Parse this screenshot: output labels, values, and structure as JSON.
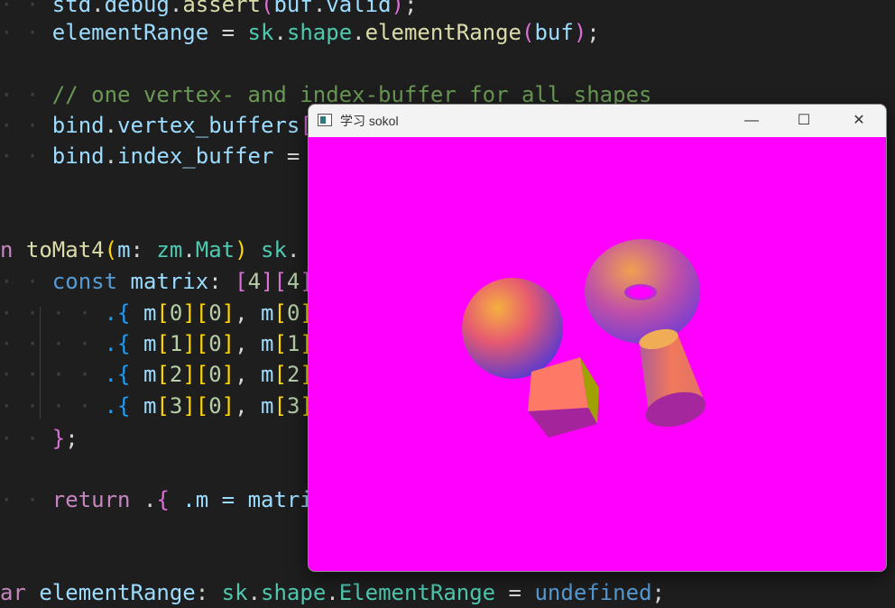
{
  "editor": {
    "indent_dots": "· · ",
    "indent_dots_inner": "· · · · ",
    "lines": {
      "l1": {
        "a": "std",
        "b": ".",
        "c": "debug",
        "d": ".",
        "e": "assert",
        "f": "(",
        "g": "buf",
        "h": ".",
        "i": "valid",
        "j": ")",
        "k": ";"
      },
      "l2": {
        "a": "elementRange",
        "b": " = ",
        "c": "sk",
        "d": ".",
        "e": "shape",
        "f": ".",
        "g": "elementRange",
        "h": "(",
        "i": "buf",
        "j": ")",
        "k": ";"
      },
      "l3": {
        "a": "// one vertex- and index-buffer for all shapes"
      },
      "l4": {
        "a": "bind",
        "b": ".",
        "c": "vertex_buffers",
        "d": "["
      },
      "l5": {
        "a": "bind",
        "b": ".",
        "c": "index_buffer",
        "d": " = "
      },
      "l6": {
        "a": "n ",
        "b": "toMat4",
        "c": "(",
        "d": "m",
        "e": ": ",
        "f": "zm",
        "g": ".",
        "h": "Mat",
        "i": ") ",
        "j": "sk",
        "k": "."
      },
      "l7": {
        "a": "const",
        "b": " matrix",
        "c": ": ",
        "d": "[",
        "e": "4",
        "f": "][",
        "g": "4",
        "h": "]"
      },
      "rows": [
        {
          "i": "0"
        },
        {
          "i": "1"
        },
        {
          "i": "2"
        },
        {
          "i": "3"
        }
      ],
      "row_tokens": {
        "open": ".{",
        "m": "m",
        "zero": "0",
        "comma": ", "
      },
      "l12": {
        "a": "}",
        "b": ";"
      },
      "l13": {
        "a": "return",
        "b": " .",
        "c": "{",
        "d": " .m = ",
        "e": "matri"
      },
      "l14": {
        "a": "ar ",
        "b": "elementRange",
        "c": ": ",
        "d": "sk",
        "e": ".",
        "f": "shape",
        "g": ".",
        "h": "ElementRange",
        "i": " = ",
        "j": "undefined",
        "k": ";"
      }
    }
  },
  "window": {
    "title": "学习 sokol",
    "min_glyph": "—",
    "max_glyph": "☐",
    "close_glyph": "✕",
    "background": "#ff00ff"
  }
}
